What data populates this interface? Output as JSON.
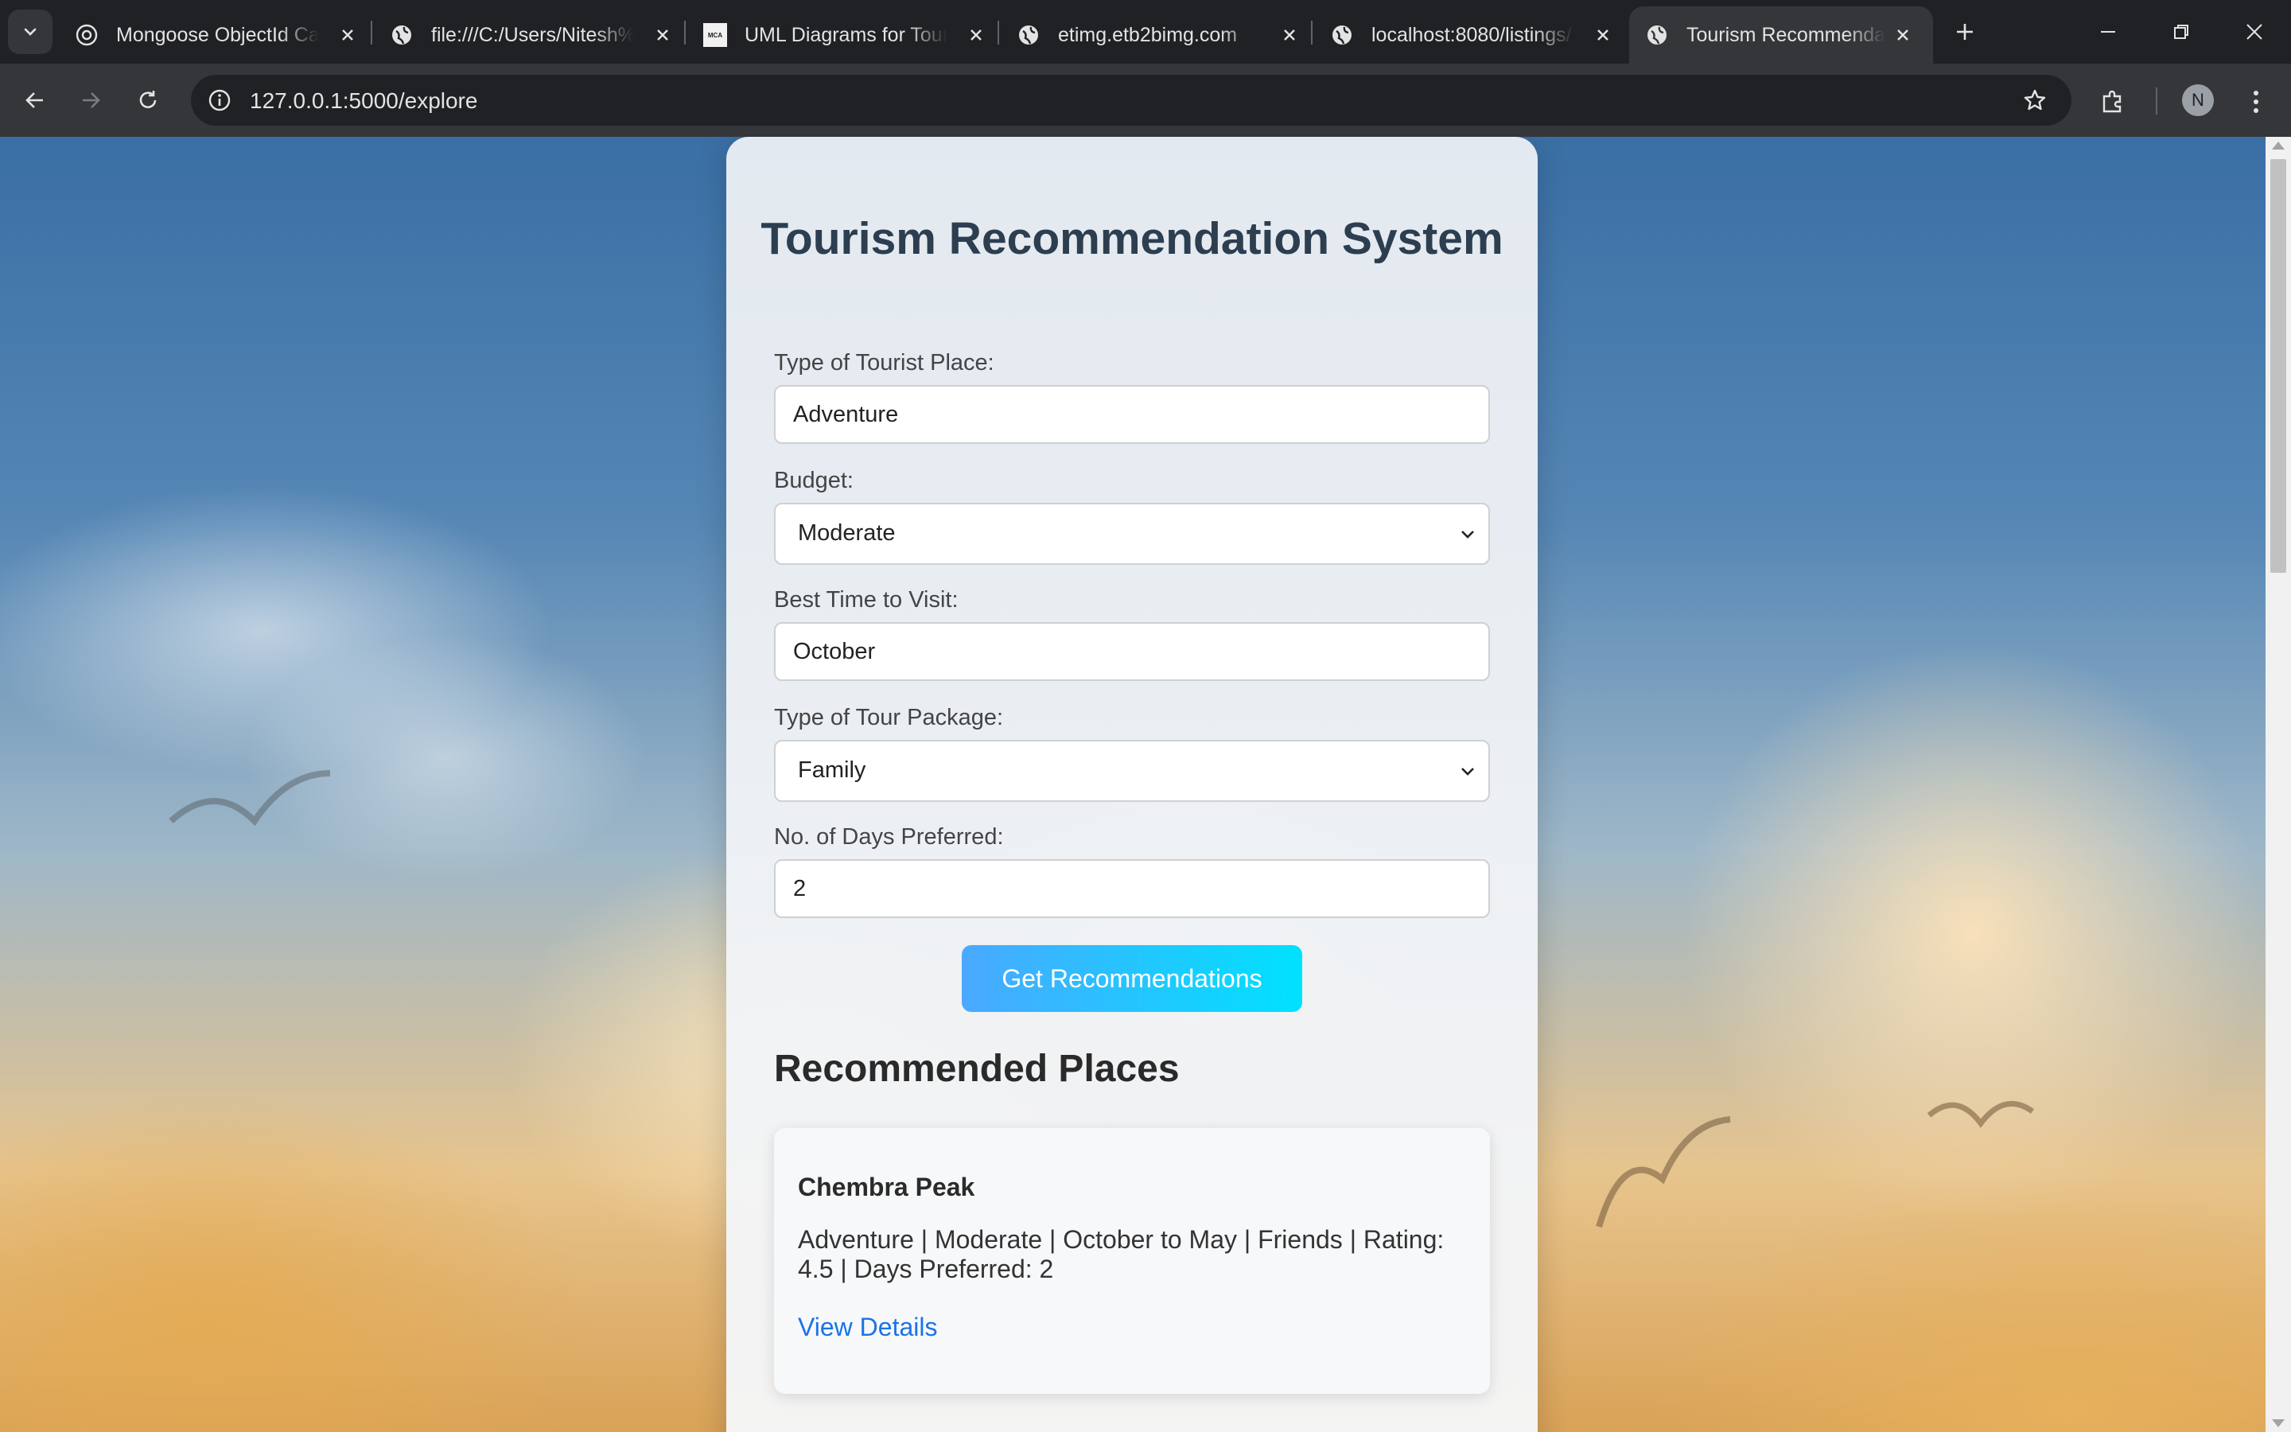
{
  "browser": {
    "tabs": [
      {
        "label": "Mongoose ObjectId Ca",
        "icon": "chatgpt-icon"
      },
      {
        "label": "file:///C:/Users/Nitesh%",
        "icon": "globe-icon"
      },
      {
        "label": "UML Diagrams for Tour",
        "icon": "mca-icon",
        "icon_text": "MCA"
      },
      {
        "label": "etimg.etb2bimg.com",
        "icon": "globe-icon"
      },
      {
        "label": "localhost:8080/listings/",
        "icon": "globe-icon"
      },
      {
        "label": "Tourism Recommendati",
        "icon": "globe-icon",
        "active": true
      }
    ],
    "url": "127.0.0.1:5000/explore",
    "profile_initial": "N"
  },
  "form": {
    "title": "Tourism Recommendation System",
    "fields": {
      "place_type": {
        "label": "Type of Tourist Place:",
        "value": "Adventure"
      },
      "budget": {
        "label": "Budget:",
        "value": "Moderate"
      },
      "best_time": {
        "label": "Best Time to Visit:",
        "value": "October"
      },
      "package": {
        "label": "Type of Tour Package:",
        "value": "Family"
      },
      "days": {
        "label": "No. of Days Preferred:",
        "value": "2"
      }
    },
    "submit_label": "Get Recommendations"
  },
  "results": {
    "heading": "Recommended Places",
    "items": [
      {
        "name": "Chembra Peak",
        "details": "Adventure | Moderate | October to May | Friends | Rating: 4.5 | Days Preferred: 2",
        "link_label": "View Details"
      }
    ]
  },
  "colors": {
    "title": "#2c3e50",
    "button_gradient_start": "#4aa8ff",
    "button_gradient_end": "#00e1ff",
    "link": "#1a73e8"
  }
}
